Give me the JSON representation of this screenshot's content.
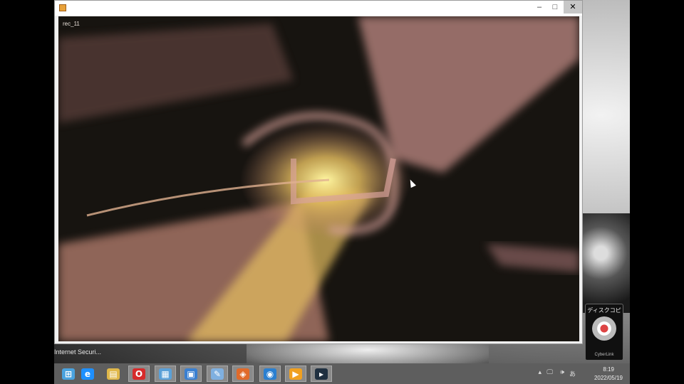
{
  "window": {
    "canvas_label": "rec_11",
    "minimize_glyph": "–",
    "maximize_glyph": "□",
    "close_glyph": "✕"
  },
  "desktop": {
    "partial_label": "Internet Securi...",
    "gadget": {
      "title": "ディスクコピー",
      "brand": "CyberLink"
    }
  },
  "taskbar": {
    "apps": [
      {
        "name": "start-button",
        "glyph": "⊞",
        "color": "#4aa3df"
      },
      {
        "name": "internet-explorer-icon",
        "glyph": "e",
        "color": "#1e90ff"
      },
      {
        "name": "file-explorer-icon",
        "glyph": "▤",
        "color": "#e0b84a"
      },
      {
        "name": "opera-icon",
        "glyph": "O",
        "color": "#d62b2b"
      },
      {
        "name": "document-icon",
        "glyph": "▦",
        "color": "#5aa0d8"
      },
      {
        "name": "network-app-icon",
        "glyph": "▣",
        "color": "#3a7fd0"
      },
      {
        "name": "paint-app-icon",
        "glyph": "✎",
        "color": "#7fb0e0"
      },
      {
        "name": "colorful-app-icon",
        "glyph": "◈",
        "color": "#e06a2a"
      },
      {
        "name": "camera-app-icon",
        "glyph": "◉",
        "color": "#2a7fd0"
      },
      {
        "name": "media-player-icon",
        "glyph": "▶",
        "color": "#f0a020"
      },
      {
        "name": "video-editor-icon",
        "glyph": "▸",
        "color": "#203040"
      }
    ],
    "tray": {
      "chevron": "▴",
      "icon1": "🖵",
      "icon2": "🕪",
      "ime": "あ",
      "clock_time": "8:19",
      "clock_date": "2022/05/19"
    }
  }
}
